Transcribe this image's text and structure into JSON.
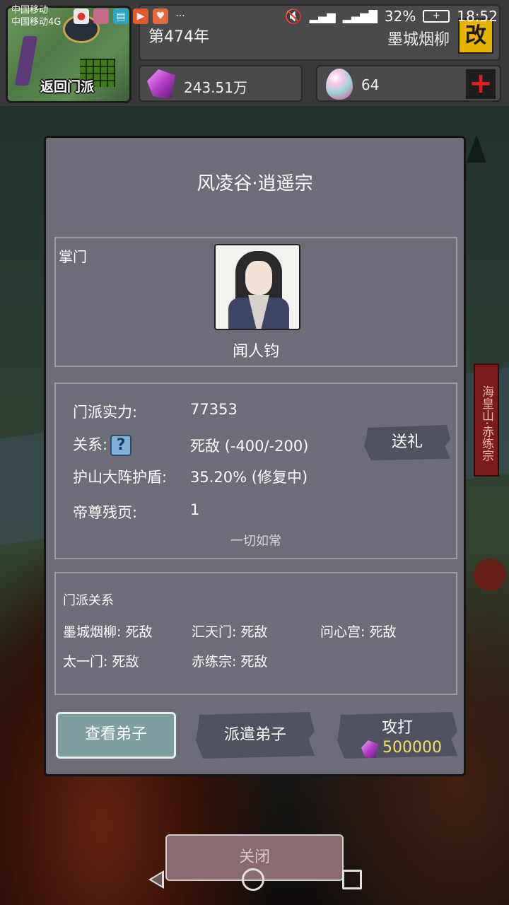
{
  "status_bar": {
    "carrier1": "中国移动",
    "carrier2": "中国移动4G",
    "battery": "32%",
    "time": "18:52"
  },
  "hud": {
    "back_label": "返回门派",
    "year": "第474年",
    "ruler": "墨城烟柳",
    "rename_label": "改",
    "crystals": "243.51万",
    "eggs": "64",
    "plus_label": "+"
  },
  "side_banner": "海皇山·赤练宗",
  "dialog": {
    "title": "风凌谷·逍遥宗",
    "master": {
      "label": "掌门",
      "name": "闻人钧"
    },
    "stats": {
      "power_label": "门派实力:",
      "power_value": "77353",
      "relation_label": "关系:",
      "relation_icon": "?",
      "relation_value": "死敌  (-400/-200)",
      "shield_label": "护山大阵护盾:",
      "shield_value": "35.20% (修复中)",
      "pages_label": "帝尊残页:",
      "pages_value": "1",
      "status_note": "一切如常"
    },
    "gift_label": "送礼",
    "relations": {
      "title": "门派关系",
      "items": [
        "墨城烟柳: 死敌",
        "汇天门: 死敌",
        "问心宫: 死敌",
        "太一门: 死敌",
        "赤练宗: 死敌"
      ]
    },
    "buttons": {
      "view": "查看弟子",
      "dispatch": "派遣弟子",
      "attack": "攻打",
      "attack_cost": "500000"
    }
  },
  "close_label": "关闭"
}
